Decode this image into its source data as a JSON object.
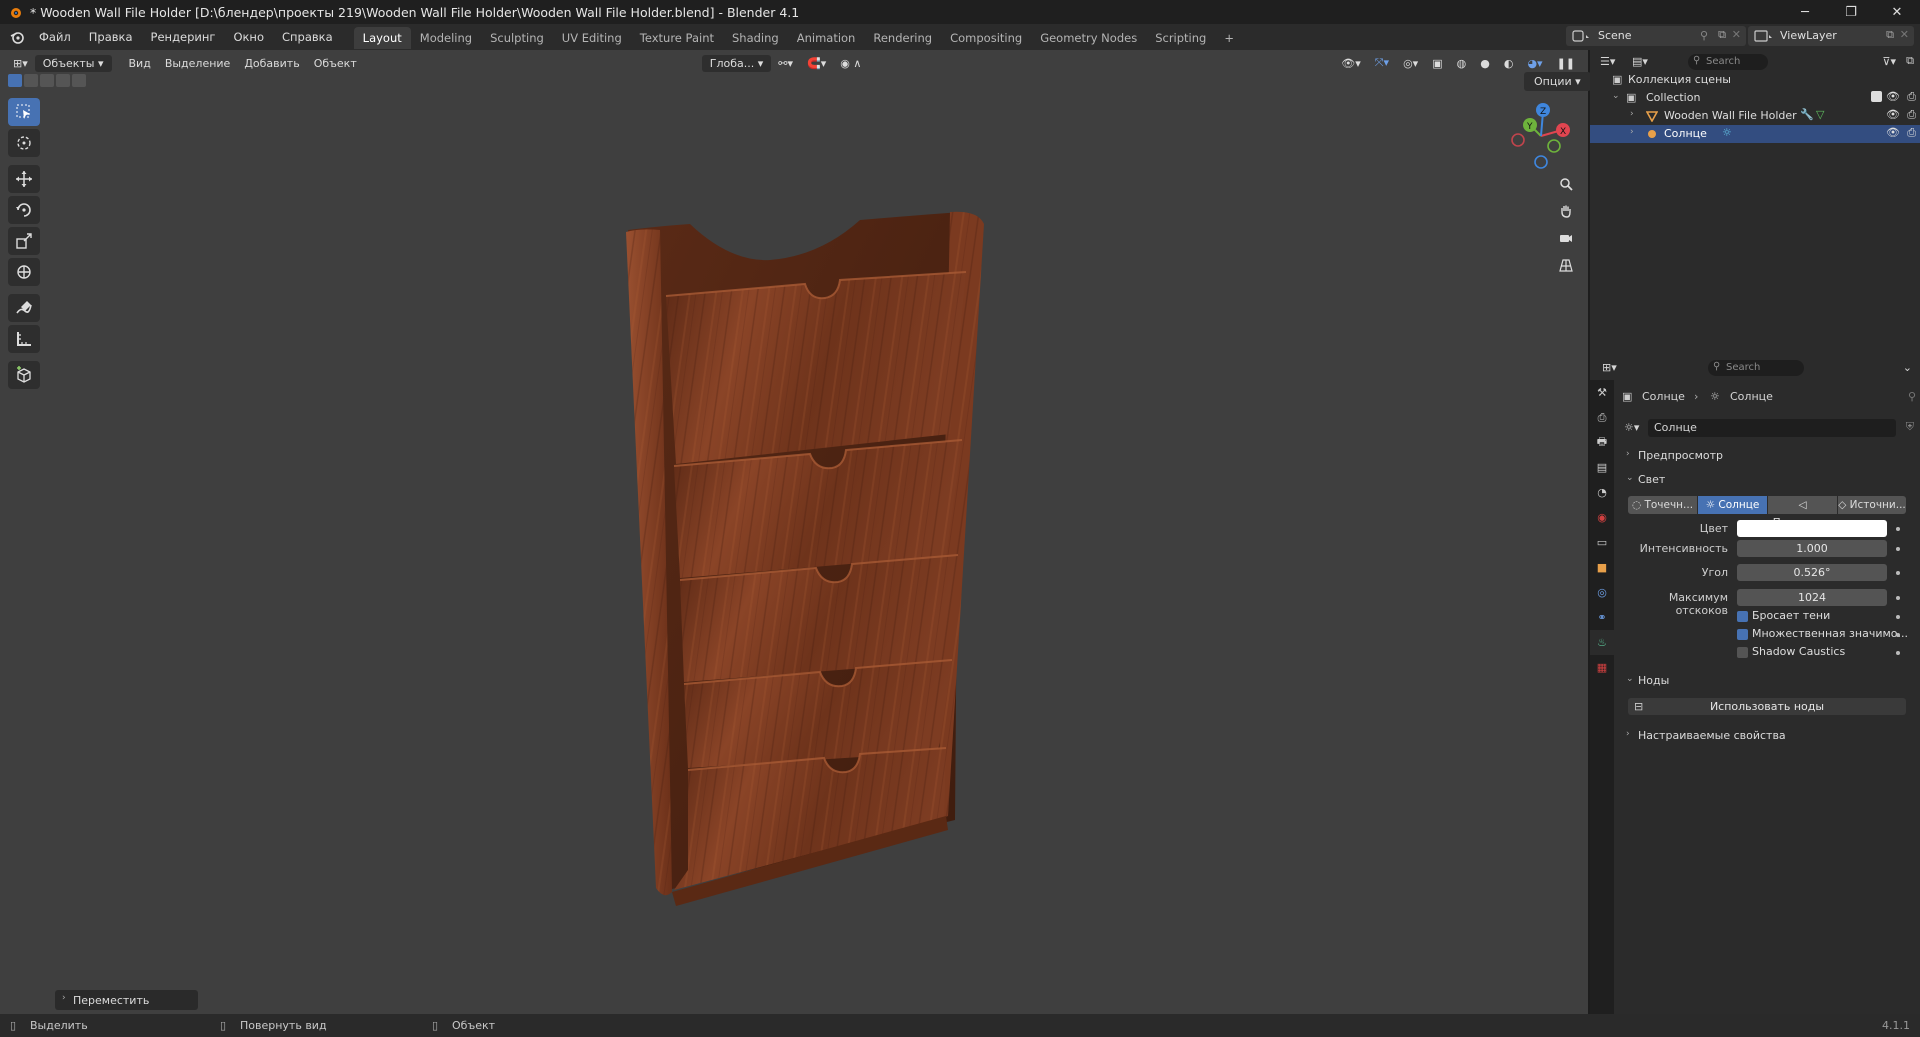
{
  "window": {
    "title": "* Wooden Wall File Holder [D:\\блендер\\проекты 219\\Wooden Wall File Holder\\Wooden Wall File Holder.blend] - Blender 4.1",
    "minimize": "─",
    "maximize": "❐",
    "close": "✕"
  },
  "menu": [
    "Файл",
    "Правка",
    "Рендеринг",
    "Окно",
    "Справка"
  ],
  "workspaces": [
    "Layout",
    "Modeling",
    "Sculpting",
    "UV Editing",
    "Texture Paint",
    "Shading",
    "Animation",
    "Rendering",
    "Compositing",
    "Geometry Nodes",
    "Scripting",
    "+"
  ],
  "active_workspace": "Layout",
  "scene": {
    "name": "Scene"
  },
  "view_layer": {
    "name": "ViewLayer"
  },
  "viewport": {
    "mode": "Объекты",
    "menus": [
      "Вид",
      "Выделение",
      "Добавить",
      "Объект"
    ],
    "transform_orientation": "Глоба...",
    "options_label": "Опции",
    "operator_panel": "Переместить",
    "gizmo": {
      "x": "X",
      "y": "Y",
      "z": "Z"
    },
    "object_name": "Wooden Wall File Holder"
  },
  "outliner": {
    "search_placeholder": "Search",
    "root": "Коллекция сцены",
    "collection": "Collection",
    "items": [
      {
        "name": "Wooden Wall File Holder",
        "selected": false
      },
      {
        "name": "Солнце",
        "selected": true
      }
    ]
  },
  "properties": {
    "search_placeholder": "Search",
    "breadcrumb": [
      "Солнце",
      "Солнце"
    ],
    "datablock": "Солнце",
    "sections": {
      "preview": "Предпросмотр",
      "light": "Свет",
      "nodes": "Ноды",
      "custom": "Настраиваемые свойства"
    },
    "light_types": [
      "Точечн...",
      "Солнце",
      "Прожект...",
      "Источни..."
    ],
    "active_light_type": "Солнце",
    "fields": {
      "color_label": "Цвет",
      "color_value": "#ffffff",
      "intensity_label": "Интенсивность",
      "intensity_value": "1.000",
      "angle_label": "Угол",
      "angle_value": "0.526°",
      "max_bounces_label": "Максимум отскоков",
      "max_bounces_value": "1024"
    },
    "checkboxes": [
      {
        "label": "Бросает тени",
        "checked": true
      },
      {
        "label": "Множественная значимо...",
        "checked": true
      },
      {
        "label": "Shadow Caustics",
        "checked": false
      }
    ],
    "use_nodes_label": "Использовать ноды"
  },
  "statusbar": {
    "select": "Выделить",
    "rotate": "Повернуть вид",
    "object": "Объект",
    "version": "4.1.1"
  },
  "colors": {
    "accent": "#4772b3",
    "selection": "#334d80",
    "viewport_bg": "#3f3f3f",
    "wood": "#7a3c22"
  }
}
